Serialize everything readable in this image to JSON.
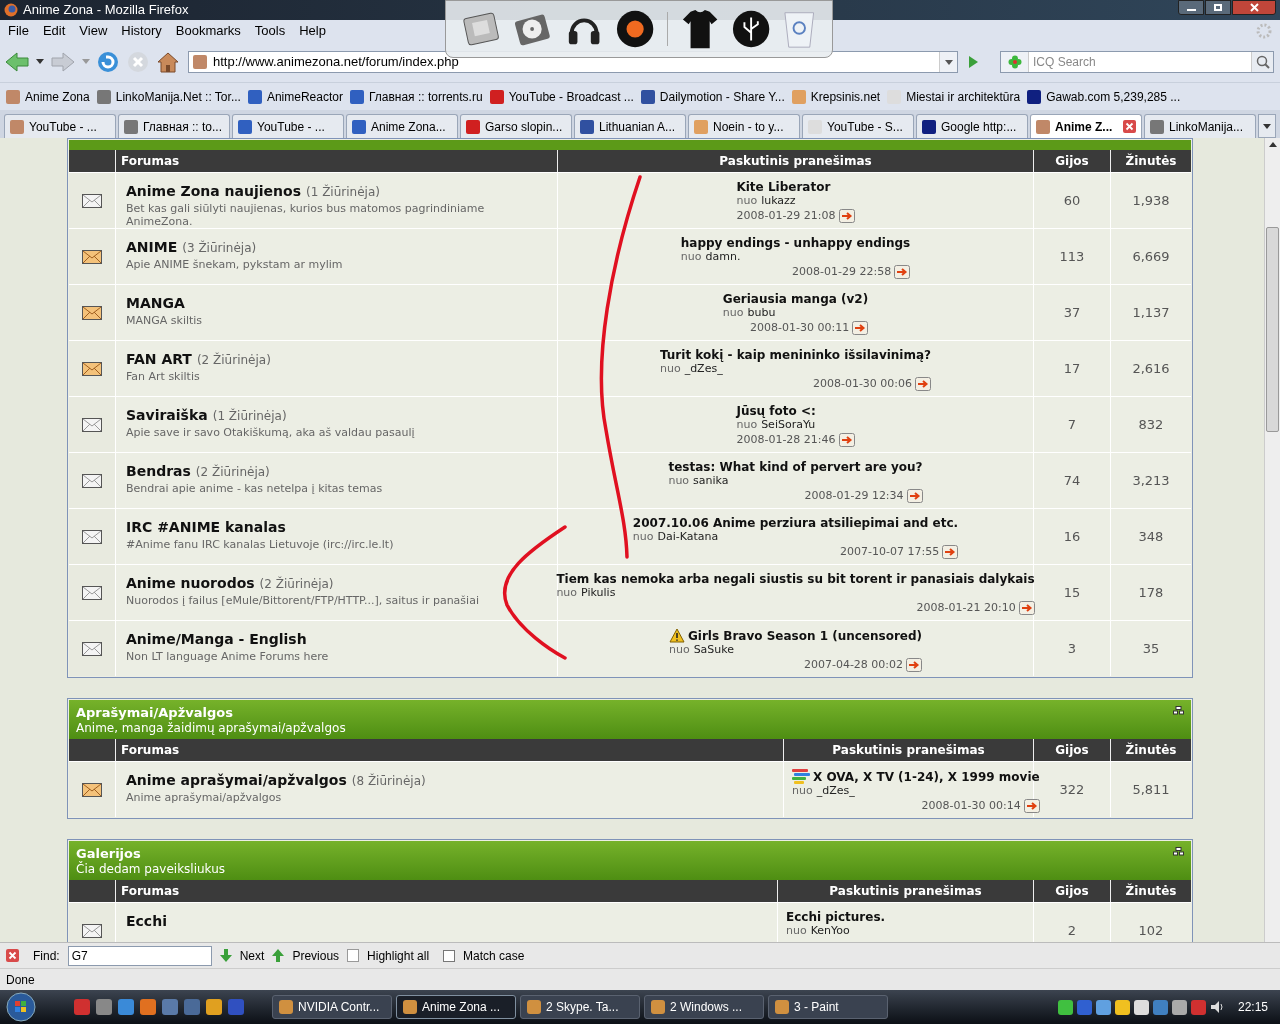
{
  "window": {
    "title": "Anime Zona - Mozilla Firefox"
  },
  "menu": [
    "File",
    "Edit",
    "View",
    "History",
    "Bookmarks",
    "Tools",
    "Help"
  ],
  "address": {
    "url": "http://www.animezona.net/forum/index.php"
  },
  "search": {
    "placeholder": "ICQ Search"
  },
  "bookmarks": [
    "Anime Zona",
    "LinkoManija.Net :: Tor...",
    "AnimeReactor",
    "Главная :: torrents.ru",
    "YouTube - Broadcast ...",
    "Dailymotion - Share Y...",
    "Krepsinis.net",
    "Miestai ir architektūra",
    "Gawab.com 5,239,285 ..."
  ],
  "tabs": [
    {
      "label": "YouTube - ...",
      "selected": false
    },
    {
      "label": "Главная :: to...",
      "selected": false
    },
    {
      "label": "YouTube - ...",
      "selected": false
    },
    {
      "label": "Anime Zona...",
      "selected": false
    },
    {
      "label": "Garso slopin...",
      "selected": false
    },
    {
      "label": "Lithuanian A...",
      "selected": false
    },
    {
      "label": "Noein - to y...",
      "selected": false
    },
    {
      "label": "YouTube - S...",
      "selected": false
    },
    {
      "label": "Google http:...",
      "selected": false
    },
    {
      "label": "Anime Z...",
      "selected": true
    },
    {
      "label": "LinkoManija...",
      "selected": false
    }
  ],
  "sections": [
    {
      "columns": [
        "Forumas",
        "Paskutinis pranešimas",
        "Gijos",
        "Žinutės"
      ],
      "forums": [
        {
          "new": false,
          "name": "Anime Zona naujienos",
          "viewers": "(1 Žiūrinėja)",
          "description": "Bet kas gali siūlyti naujienas, kurios bus matomos pagrindiniame AnimeZona.",
          "last_post": {
            "title": "Kite Liberator",
            "by": "nuo",
            "author": "lukazz",
            "date": "2008-01-29 21:08"
          },
          "threads": "60",
          "posts": "1,938"
        },
        {
          "new": true,
          "name": "ANIME",
          "viewers": "(3 Žiūrinėja)",
          "description": "Apie ANIME šnekam, pykstam ar mylim",
          "last_post": {
            "title": "happy endings - unhappy endings",
            "by": "nuo",
            "author": "damn.",
            "date": "2008-01-29 22:58"
          },
          "threads": "113",
          "posts": "6,669"
        },
        {
          "new": true,
          "name": "MANGA",
          "description": "MANGA skiltis",
          "last_post": {
            "title": "Geriausia manga (v2)",
            "by": "nuo",
            "author": "bubu",
            "date": "2008-01-30 00:11"
          },
          "threads": "37",
          "posts": "1,137"
        },
        {
          "new": true,
          "name": "FAN ART",
          "viewers": "(2 Žiūrinėja)",
          "description": "Fan Art skiltis",
          "last_post": {
            "title": "Turit kokį - kaip menininko išsilavinimą?",
            "by": "nuo",
            "author": "_dZes_",
            "date": "2008-01-30 00:06"
          },
          "threads": "17",
          "posts": "2,616"
        },
        {
          "new": false,
          "name": "Saviraiška",
          "viewers": "(1 Žiūrinėja)",
          "description": "Apie save ir savo Otakiškumą, aka aš valdau pasaulį",
          "last_post": {
            "title": "Jūsų foto <:",
            "by": "nuo",
            "author": "SeiSoraYu",
            "date": "2008-01-28 21:46"
          },
          "threads": "7",
          "posts": "832"
        },
        {
          "new": false,
          "name": "Bendras",
          "viewers": "(2 Žiūrinėja)",
          "description": "Bendrai apie anime - kas netelpa į kitas temas",
          "last_post": {
            "title": "testas: What kind of pervert are you?",
            "by": "nuo",
            "author": "sanika",
            "date": "2008-01-29 12:34"
          },
          "threads": "74",
          "posts": "3,213"
        },
        {
          "new": false,
          "name": "IRC #ANIME kanalas",
          "description": "#Anime fanu IRC kanalas Lietuvoje (irc://irc.le.lt)",
          "last_post": {
            "title": "2007.10.06 Anime perziura atsiliepimai and etc.",
            "by": "nuo",
            "author": "Dai-Katana",
            "date": "2007-10-07 17:55"
          },
          "threads": "16",
          "posts": "348"
        },
        {
          "new": false,
          "name": "Anime nuorodos",
          "viewers": "(2 Žiūrinėja)",
          "description": "Nuorodos į failus [eMule/Bittorent/FTP/HTTP...], saitus ir panašiai",
          "last_post": {
            "title": "Tiem kas nemoka arba negali siustis su bit torent ir panasiais dalykais",
            "by": "nuo",
            "author": "Pikulis",
            "date": "2008-01-21 20:10"
          },
          "threads": "15",
          "posts": "178"
        },
        {
          "new": false,
          "name": "Anime/Manga - English",
          "description": "Non LT language Anime Forums here",
          "last_post": {
            "kind": "warning",
            "title": "Girls Bravo Season 1 (uncensored)",
            "by": "nuo",
            "author": "SaSuke",
            "date": "2007-04-28 00:02"
          },
          "threads": "3",
          "posts": "35"
        }
      ]
    },
    {
      "title": "Aprašymai/Apžvalgos",
      "subtitle": "Anime, manga žaidimų aprašymai/apžvalgos",
      "columns": [
        "Forumas",
        "Paskutinis pranešimas",
        "Gijos",
        "Žinutės"
      ],
      "forums": [
        {
          "new": true,
          "name": "Anime aprašymai/apžvalgos",
          "viewers": "(8 Žiūrinėja)",
          "description": "Anime aprašymai/apžvalgos",
          "last_post": {
            "kind": "stripes",
            "title": "X OVA, X TV (1-24), X 1999 movie",
            "by": "nuo",
            "author": "_dZes_",
            "date": "2008-01-30 00:14"
          },
          "threads": "322",
          "posts": "5,811"
        }
      ]
    },
    {
      "title": "Galerijos",
      "subtitle": "Čia dedam paveiksliukus",
      "columns": [
        "Forumas",
        "Paskutinis pranešimas",
        "Gijos",
        "Žinutės"
      ],
      "forums": [
        {
          "new": false,
          "name": "Ecchi",
          "last_post": {
            "title": "Ecchi pictures.",
            "by": "nuo",
            "author": "KenYoo"
          },
          "threads": "2",
          "posts": "102"
        }
      ]
    }
  ],
  "find_bar": {
    "label": "Find:",
    "value": "G7",
    "next": "Next",
    "previous": "Previous",
    "highlight_all": "Highlight all",
    "match_case": {
      "label": "Match case",
      "checked": false
    }
  },
  "status": "Done",
  "taskbar": {
    "tasks": [
      {
        "label": "NVIDIA Contr...",
        "selected": false
      },
      {
        "label": "Anime Zona ...",
        "selected": true
      },
      {
        "label": "2 Skype. Ta...",
        "selected": false
      },
      {
        "label": "2 Windows ...",
        "selected": false
      },
      {
        "label": "3 - Paint",
        "selected": false
      }
    ],
    "clock": "22:15"
  }
}
